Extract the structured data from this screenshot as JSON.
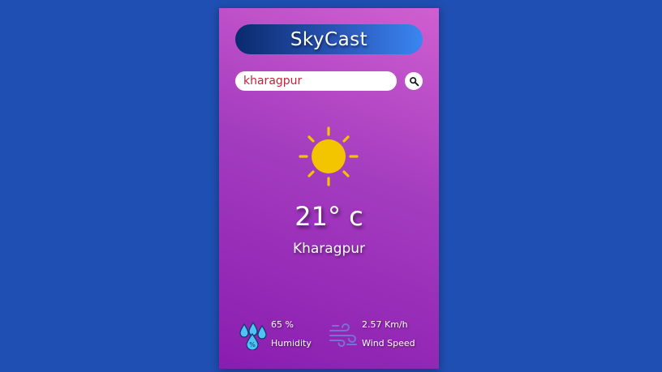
{
  "app": {
    "title": "SkyCast"
  },
  "search": {
    "value": "kharagpur",
    "placeholder": "",
    "button_icon": "search-icon"
  },
  "weather": {
    "icon": "sun-icon",
    "temperature": "21° c",
    "city": "Kharagpur"
  },
  "details": {
    "humidity": {
      "icon": "humidity-icon",
      "value": "65 %",
      "label": "Humidity"
    },
    "wind": {
      "icon": "wind-icon",
      "value": "2.57 Km/h",
      "label": "Wind Speed"
    }
  },
  "colors": {
    "background": "#1f4fb2",
    "card_top": "#d05fd0",
    "card_bottom": "#8a1db0",
    "sun": "#f2c500",
    "search_text": "#cc1f3a"
  }
}
